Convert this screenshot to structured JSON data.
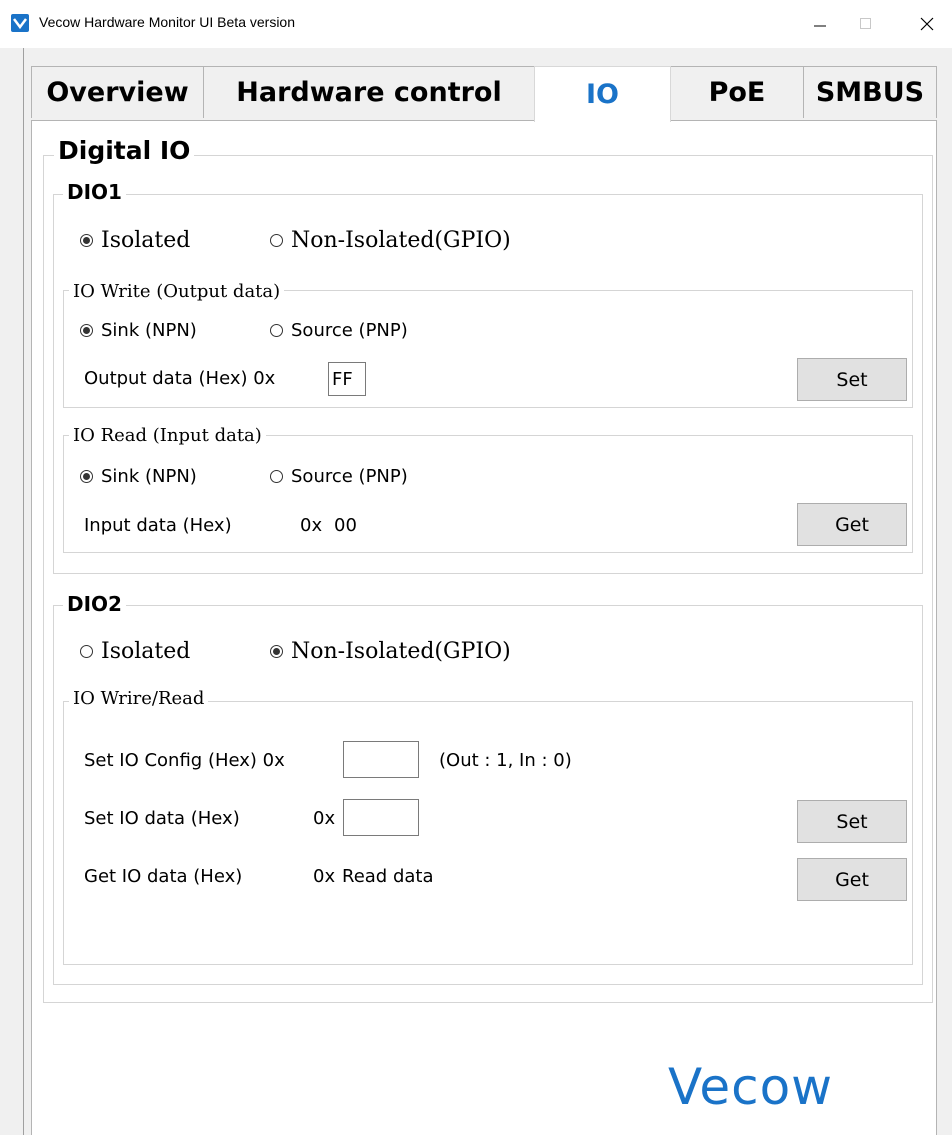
{
  "window": {
    "title": "Vecow Hardware Monitor UI Beta version"
  },
  "tabs": [
    {
      "label": "Overview"
    },
    {
      "label": "Hardware control"
    },
    {
      "label": "IO"
    },
    {
      "label": "PoE"
    },
    {
      "label": "SMBUS"
    }
  ],
  "digital_io": {
    "title": "Digital IO",
    "dio1": {
      "title": "DIO1",
      "mode_isolated": "Isolated",
      "mode_non_isolated": "Non-Isolated(GPIO)",
      "write": {
        "title": "IO Write (Output data)",
        "sink": "Sink (NPN)",
        "source": "Source (PNP)",
        "output_label": "Output data (Hex) 0x",
        "output_value": "FF",
        "set_label": "Set"
      },
      "read": {
        "title": "IO Read (Input data)",
        "sink": "Sink (NPN)",
        "source": "Source (PNP)",
        "input_label": "Input data (Hex)",
        "input_prefix": "0x",
        "input_value": "00",
        "get_label": "Get"
      }
    },
    "dio2": {
      "title": "DIO2",
      "mode_isolated": "Isolated",
      "mode_non_isolated": "Non-Isolated(GPIO)",
      "rw": {
        "title": "IO Wrire/Read",
        "config_label": "Set IO Config (Hex) 0x",
        "config_value": "",
        "config_hint": "(Out : 1, In : 0)",
        "set_data_label": "Set IO data (Hex)",
        "set_data_prefix": "0x",
        "set_data_value": "",
        "set_label": "Set",
        "get_data_label": "Get IO data (Hex)",
        "get_data_prefix": "0x",
        "get_data_value": "Read data",
        "get_label": "Get"
      }
    }
  },
  "logo": "Vecow",
  "colors": {
    "accent": "#1a73c8"
  }
}
